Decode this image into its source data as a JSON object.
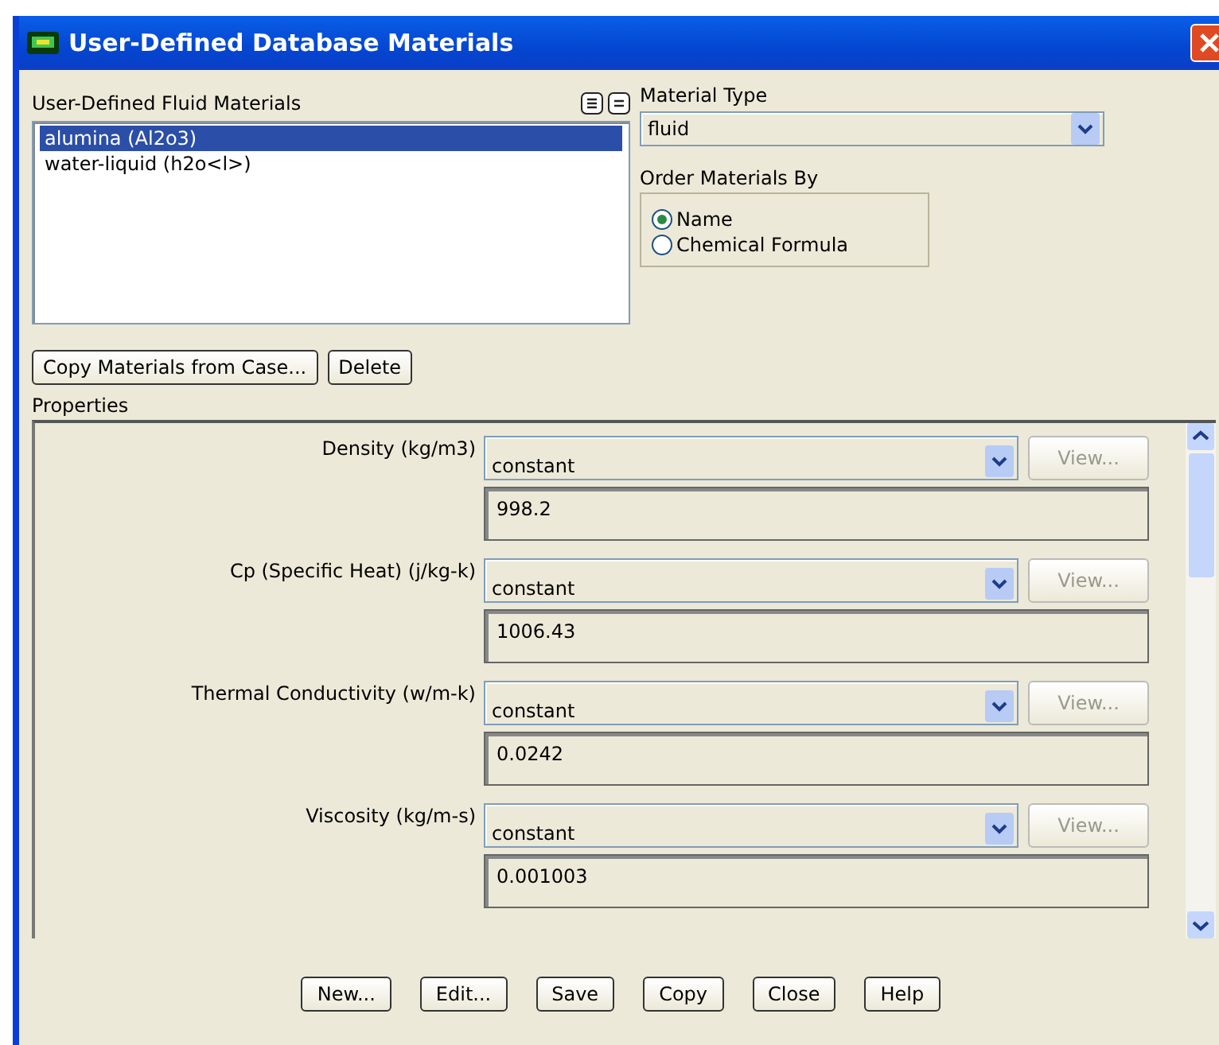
{
  "window": {
    "title": "User-Defined Database Materials"
  },
  "materials_list": {
    "label": "User-Defined Fluid Materials",
    "items": [
      {
        "label": "alumina (Al2o3)",
        "selected": true
      },
      {
        "label": "water-liquid (h2o<l>)",
        "selected": false
      }
    ]
  },
  "material_type": {
    "label": "Material Type",
    "value": "fluid"
  },
  "order_by": {
    "label": "Order Materials By",
    "options": [
      {
        "label": "Name",
        "selected": true
      },
      {
        "label": "Chemical Formula",
        "selected": false
      }
    ]
  },
  "list_buttons": [
    {
      "label": "Copy Materials from Case..."
    },
    {
      "label": "Delete"
    }
  ],
  "properties": {
    "label": "Properties",
    "rows": [
      {
        "name": "Density (kg/m3)",
        "method": "constant",
        "view_button": "View...",
        "view_disabled": true,
        "value": "998.2"
      },
      {
        "name": "Cp (Specific Heat) (j/kg-k)",
        "method": "constant",
        "view_button": "View...",
        "view_disabled": true,
        "value": "1006.43"
      },
      {
        "name": "Thermal Conductivity (w/m-k)",
        "method": "constant",
        "view_button": "View...",
        "view_disabled": true,
        "value": "0.0242"
      },
      {
        "name": "Viscosity (kg/m-s)",
        "method": "constant",
        "view_button": "View...",
        "view_disabled": true,
        "value": "0.001003"
      }
    ]
  },
  "buttons": [
    {
      "label": "New..."
    },
    {
      "label": "Edit..."
    },
    {
      "label": "Save"
    },
    {
      "label": "Copy"
    },
    {
      "label": "Close"
    },
    {
      "label": "Help"
    }
  ]
}
